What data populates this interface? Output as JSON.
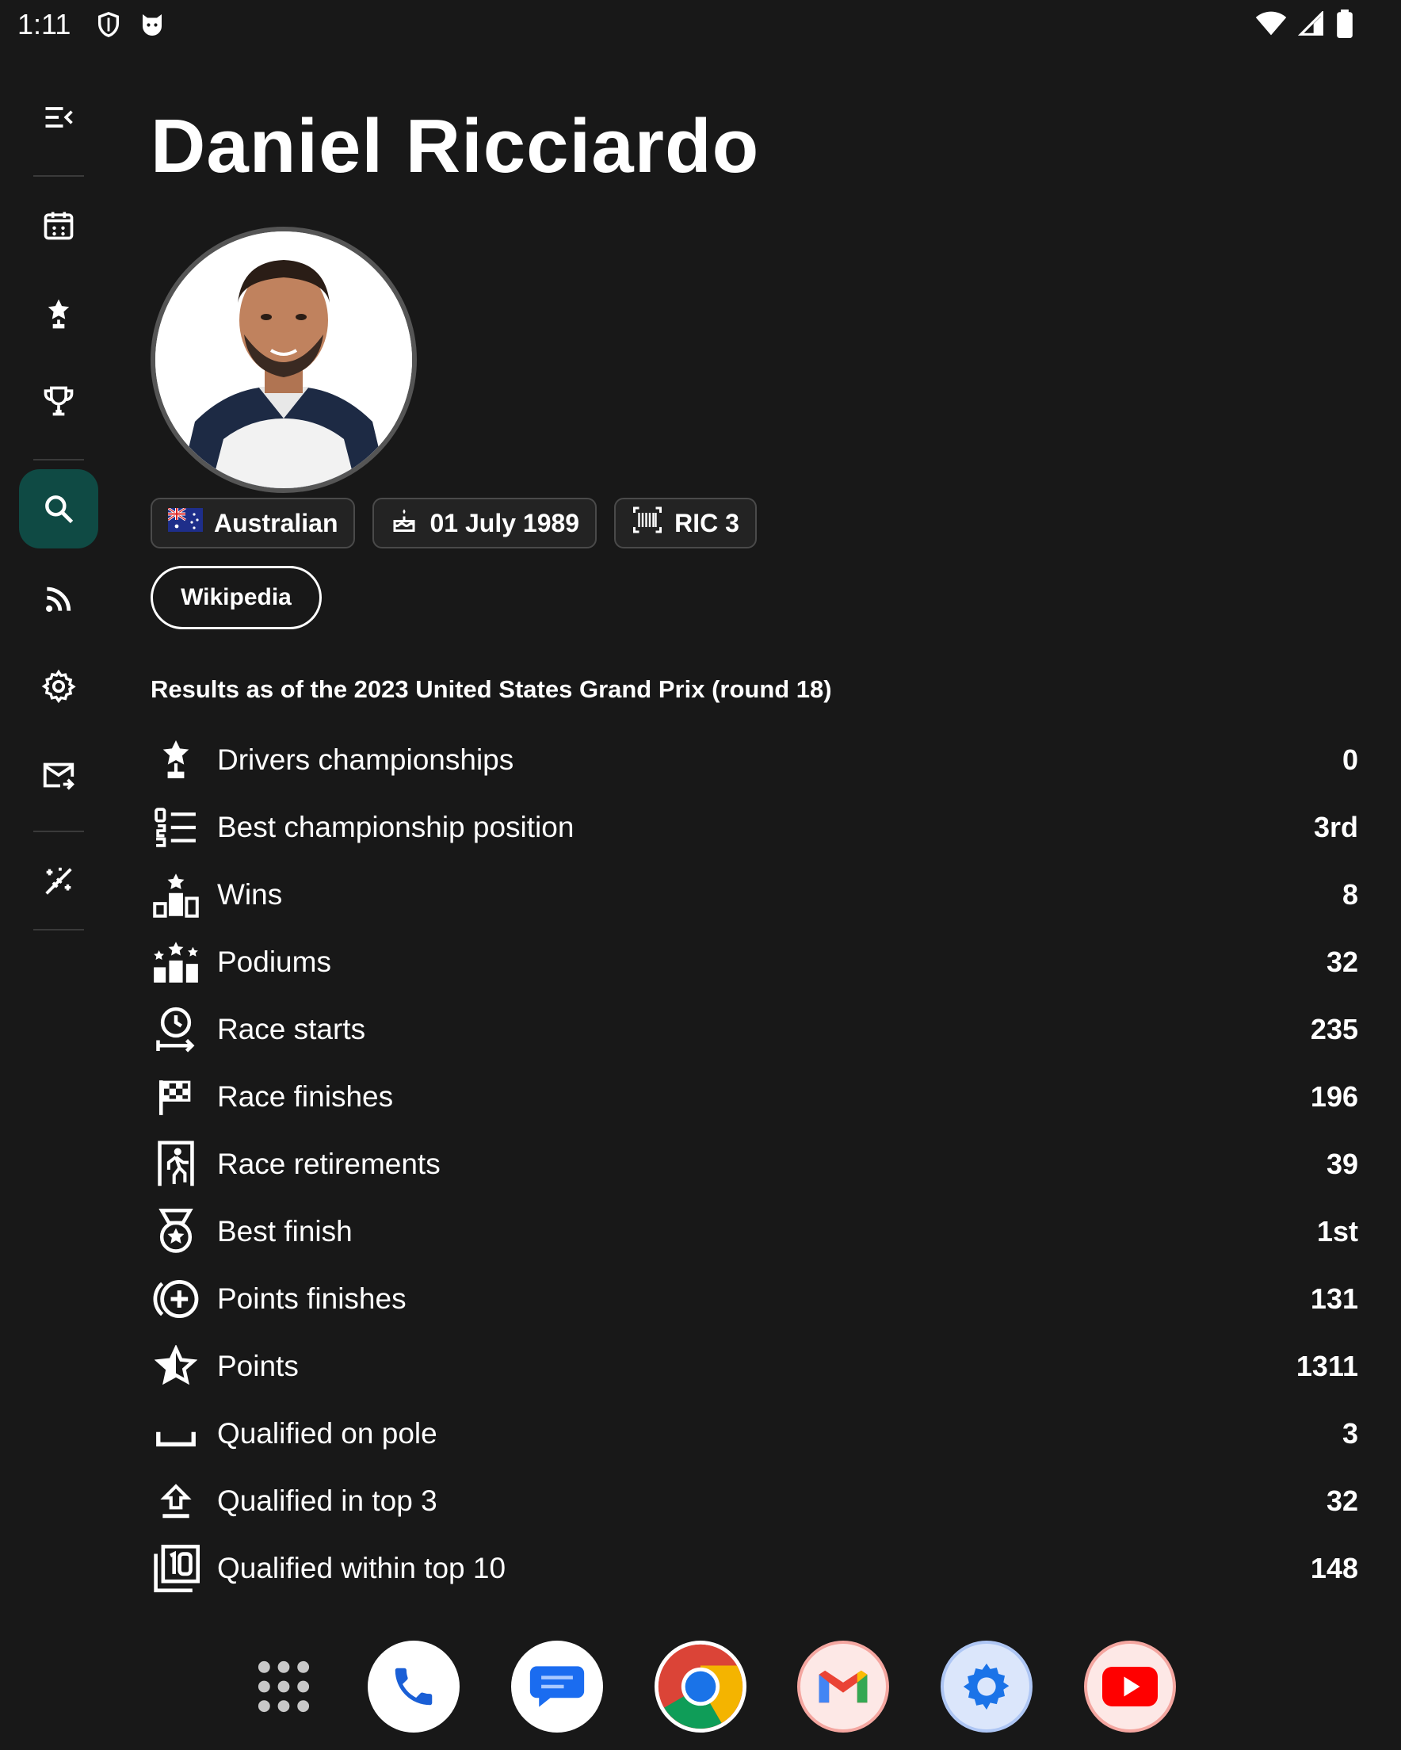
{
  "status_bar": {
    "time": "1:11",
    "left_icons": [
      "shield-icon",
      "cat-icon"
    ],
    "right_icons": [
      "wifi-icon",
      "signal-icon",
      "battery-icon"
    ]
  },
  "nav_rail": {
    "items": [
      {
        "name": "menu-collapse-icon"
      },
      {
        "name": "calendar-icon"
      },
      {
        "name": "star-trophy-icon"
      },
      {
        "name": "trophy-icon"
      },
      {
        "name": "search-icon",
        "active": true
      },
      {
        "name": "rss-feed-icon"
      },
      {
        "name": "settings-icon"
      },
      {
        "name": "mail-forward-icon"
      },
      {
        "name": "magic-off-icon"
      }
    ],
    "active_color": "#0f4a44"
  },
  "driver": {
    "name": "Daniel Ricciardo",
    "nationality": "Australian",
    "birth_date": "01 July 1989",
    "code_number": "RIC 3",
    "wikipedia_label": "Wikipedia"
  },
  "results_note": "Results as of the 2023 United States Grand Prix (round 18)",
  "stats": [
    {
      "label": "Drivers championships",
      "value": "0",
      "icon": "championship-star-icon"
    },
    {
      "label": "Best championship position",
      "value": "3rd",
      "icon": "ranked-list-icon"
    },
    {
      "label": "Wins",
      "value": "8",
      "icon": "podium-star-icon"
    },
    {
      "label": "Podiums",
      "value": "32",
      "icon": "podium-stars-icon"
    },
    {
      "label": "Race starts",
      "value": "235",
      "icon": "clock-start-icon"
    },
    {
      "label": "Race finishes",
      "value": "196",
      "icon": "checkered-flag-icon"
    },
    {
      "label": "Race retirements",
      "value": "39",
      "icon": "exit-person-icon"
    },
    {
      "label": "Best finish",
      "value": "1st",
      "icon": "medal-icon"
    },
    {
      "label": "Points finishes",
      "value": "131",
      "icon": "plus-circle-icon"
    },
    {
      "label": "Points",
      "value": "1311",
      "icon": "star-outline-icon"
    },
    {
      "label": "Qualified on pole",
      "value": "3",
      "icon": "space-bar-icon"
    },
    {
      "label": "Qualified in top 3",
      "value": "32",
      "icon": "upload-arrow-icon"
    },
    {
      "label": "Qualified within top 10",
      "value": "148",
      "icon": "top-ten-icon"
    }
  ],
  "dock": [
    {
      "name": "app-drawer-icon"
    },
    {
      "name": "phone-app-icon"
    },
    {
      "name": "messages-app-icon"
    },
    {
      "name": "chrome-app-icon"
    },
    {
      "name": "gmail-app-icon"
    },
    {
      "name": "settings-app-icon"
    },
    {
      "name": "youtube-app-icon"
    }
  ]
}
